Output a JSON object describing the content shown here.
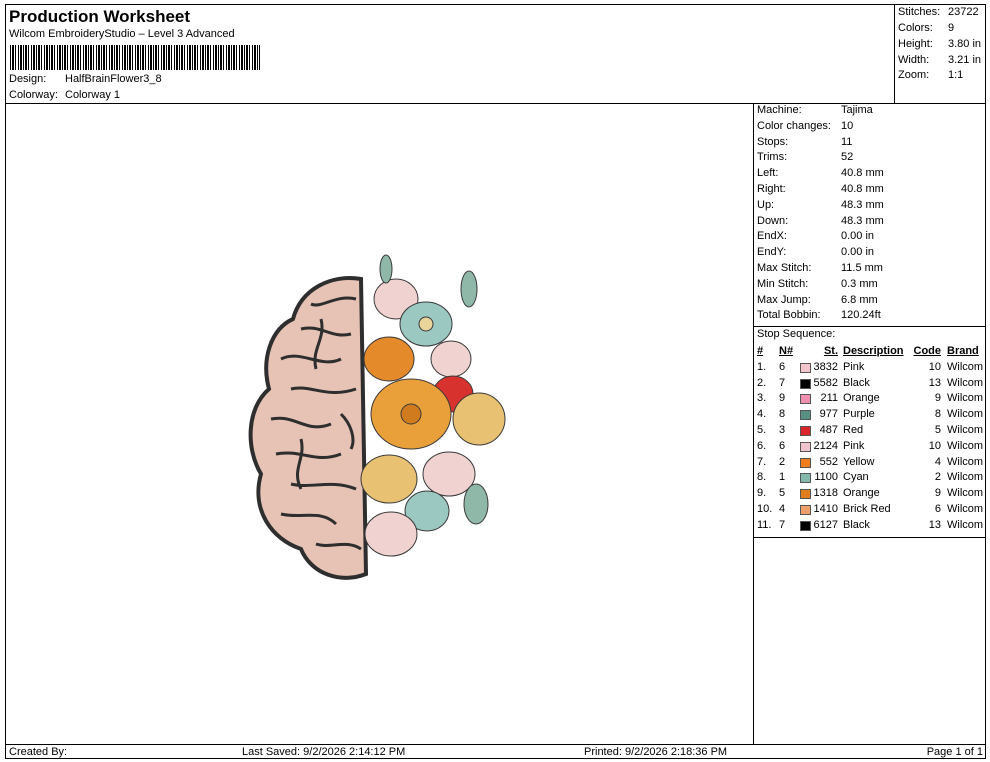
{
  "header": {
    "title": "Production Worksheet",
    "subtitle": "Wilcom EmbroideryStudio – Level 3 Advanced",
    "design_label": "Design:",
    "design_value": "HalfBrainFlower3_8",
    "colorway_label": "Colorway:",
    "colorway_value": "Colorway 1"
  },
  "stats": [
    {
      "k": "Stitches:",
      "v": "23722"
    },
    {
      "k": "Colors:",
      "v": "9"
    },
    {
      "k": "Height:",
      "v": "3.80 in"
    },
    {
      "k": "Width:",
      "v": "3.21 in"
    },
    {
      "k": "Zoom:",
      "v": "1:1"
    }
  ],
  "machine_info": [
    {
      "k": "Machine:",
      "v": "Tajima"
    },
    {
      "k": "Color changes:",
      "v": "10"
    },
    {
      "k": "Stops:",
      "v": "11"
    },
    {
      "k": "Trims:",
      "v": "52"
    },
    {
      "k": "Left:",
      "v": "40.8 mm"
    },
    {
      "k": "Right:",
      "v": "40.8 mm"
    },
    {
      "k": "Up:",
      "v": "48.3 mm"
    },
    {
      "k": "Down:",
      "v": "48.3 mm"
    },
    {
      "k": "EndX:",
      "v": "0.00 in"
    },
    {
      "k": "EndY:",
      "v": "0.00 in"
    },
    {
      "k": "Max Stitch:",
      "v": "11.5 mm"
    },
    {
      "k": "Min Stitch:",
      "v": "0.3 mm"
    },
    {
      "k": "Max Jump:",
      "v": "6.8 mm"
    },
    {
      "k": "Total Bobbin:",
      "v": "120.24ft"
    }
  ],
  "stop_sequence": {
    "title": "Stop Sequence:",
    "columns": [
      "#",
      "N#",
      "St.",
      "Description",
      "Code",
      "Brand"
    ],
    "rows": [
      {
        "i": "1.",
        "n": "6",
        "color": "#f2c4cc",
        "st": "3832",
        "desc": "Pink",
        "code": "10",
        "brand": "Wilcom"
      },
      {
        "i": "2.",
        "n": "7",
        "color": "#000000",
        "st": "5582",
        "desc": "Black",
        "code": "13",
        "brand": "Wilcom"
      },
      {
        "i": "3.",
        "n": "9",
        "color": "#ee8fb0",
        "st": "211",
        "desc": "Orange",
        "code": "9",
        "brand": "Wilcom"
      },
      {
        "i": "4.",
        "n": "8",
        "color": "#5a8f86",
        "st": "977",
        "desc": "Purple",
        "code": "8",
        "brand": "Wilcom"
      },
      {
        "i": "5.",
        "n": "3",
        "color": "#d8242a",
        "st": "487",
        "desc": "Red",
        "code": "5",
        "brand": "Wilcom"
      },
      {
        "i": "6.",
        "n": "6",
        "color": "#f2c4cc",
        "st": "2124",
        "desc": "Pink",
        "code": "10",
        "brand": "Wilcom"
      },
      {
        "i": "7.",
        "n": "2",
        "color": "#ef7d1a",
        "st": "552",
        "desc": "Yellow",
        "code": "4",
        "brand": "Wilcom"
      },
      {
        "i": "8.",
        "n": "1",
        "color": "#86b7ad",
        "st": "1100",
        "desc": "Cyan",
        "code": "2",
        "brand": "Wilcom"
      },
      {
        "i": "9.",
        "n": "5",
        "color": "#e07d1d",
        "st": "1318",
        "desc": "Orange",
        "code": "9",
        "brand": "Wilcom"
      },
      {
        "i": "10.",
        "n": "4",
        "color": "#eea06a",
        "st": "1410",
        "desc": "Brick Red",
        "code": "6",
        "brand": "Wilcom"
      },
      {
        "i": "11.",
        "n": "7",
        "color": "#000000",
        "st": "6127",
        "desc": "Black",
        "code": "13",
        "brand": "Wilcom"
      }
    ]
  },
  "footer": {
    "created": "Created By:",
    "saved": "Last Saved: 9/2/2026 2:14:12 PM",
    "printed": "Printed: 9/2/2026 2:18:36 PM",
    "page": "Page 1 of 1"
  }
}
